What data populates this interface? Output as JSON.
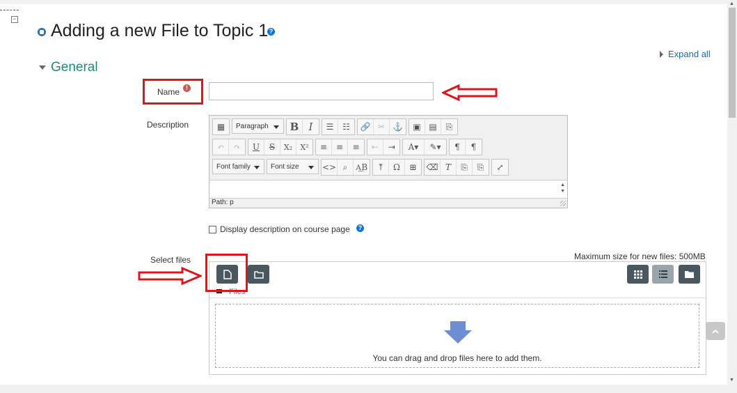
{
  "page": {
    "title": "Adding a new File to Topic 1",
    "expand_all": "Expand all",
    "section": "General"
  },
  "form": {
    "name_label": "Name",
    "name_value": "",
    "description_label": "Description",
    "display_description_label": "Display description on course page",
    "select_files_label": "Select files",
    "max_size": "Maximum size for new files: 500MB"
  },
  "editor": {
    "paragraph_select": "Paragraph",
    "font_family_select": "Font family",
    "font_size_select": "Font size",
    "path": "Path: p"
  },
  "filepicker": {
    "breadcrumb": "Files",
    "drop_text": "You can drag and drop files here to add them."
  },
  "colors": {
    "accent_teal": "#1e8a7d",
    "link_blue": "#0f6cbf",
    "annotation_red": "#e1131c",
    "dark_button": "#49575f"
  }
}
